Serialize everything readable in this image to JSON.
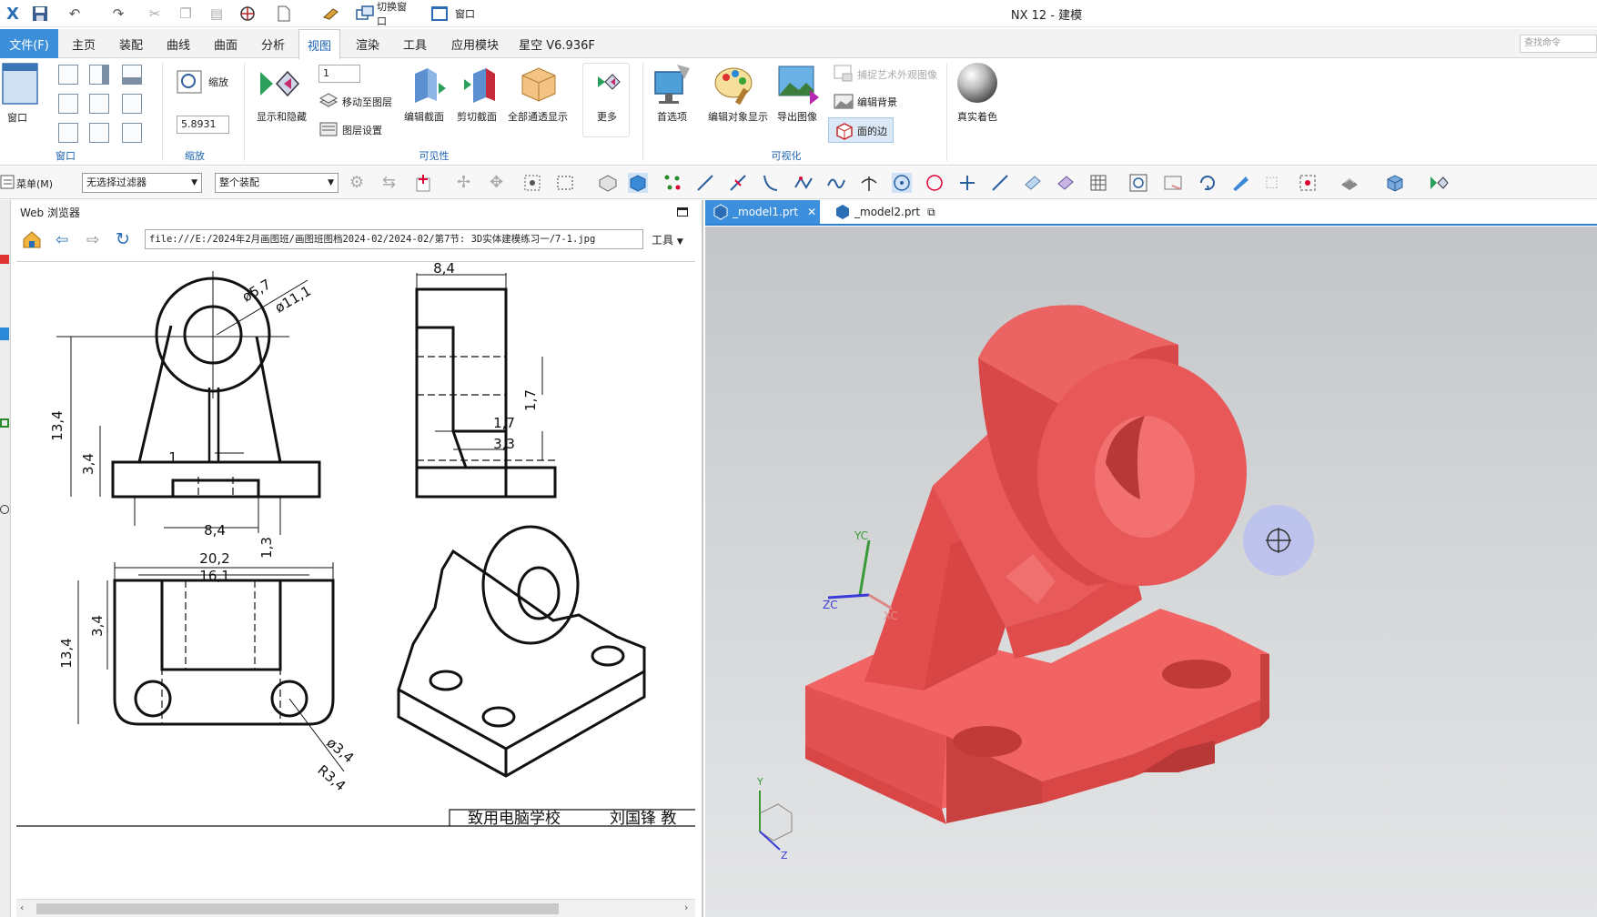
{
  "app": {
    "title": "NX 12 - 建模",
    "logo": "X"
  },
  "menubar": {
    "file": "文件(F)",
    "tabs": [
      "主页",
      "装配",
      "曲线",
      "曲面",
      "分析",
      "视图",
      "渲染",
      "工具",
      "应用模块",
      "星空 V6.936F"
    ],
    "active_tab": "视图",
    "search_placeholder": "查找命令"
  },
  "quick_access": {
    "switch_window": "切换窗口",
    "window": "窗口"
  },
  "ribbon": {
    "window_group": {
      "label": "窗口",
      "button": "窗口"
    },
    "zoom_group": {
      "label": "缩放",
      "zoom_button": "缩放",
      "zoom_value": "5.8931"
    },
    "layer_value": "1",
    "visibility_group": {
      "label": "可见性",
      "show_hide": "显示和隐藏",
      "move_to_layer": "移动至图层",
      "layer_settings": "图层设置",
      "edit_section": "编辑截面",
      "clip_section": "剪切截面",
      "all_transparent": "全部通透显示",
      "more": "更多"
    },
    "visualization_group": {
      "label": "可视化",
      "preferences": "首选项",
      "edit_object_display": "编辑对象显示",
      "export_image": "导出图像",
      "capture_art": "捕捉艺术外观图像",
      "edit_background": "编辑背景",
      "face_edges": "面的边",
      "true_shading": "真实着色"
    }
  },
  "selection_bar": {
    "menu": "菜单(M)",
    "filter": "无选择过滤器",
    "scope": "整个装配"
  },
  "browser": {
    "title": "Web 浏览器",
    "url": "file:///E:/2024年2月画图班/画图班图档2024-02/2024-02/第7节: 3D实体建模练习一/7-1.jpg",
    "tools": "工具",
    "drawing": {
      "dims": [
        "8,4",
        "ø5,7",
        "ø11,1",
        "13,4",
        "3,4",
        "1",
        "8,4",
        "1,3",
        "1,7",
        "1,7",
        "3,3",
        "20,2",
        "16,1",
        "13,4",
        "3,4",
        "ø3,4",
        "R3,4"
      ],
      "title_block": [
        "致用电脑学校",
        "刘国锋 教"
      ]
    }
  },
  "graphics": {
    "tabs": [
      {
        "label": "_model1.prt",
        "active": true
      },
      {
        "label": "_model2.prt",
        "active": false
      }
    ],
    "model_color": "#e85050",
    "axes": [
      "YC",
      "ZC",
      "XC"
    ],
    "triad": [
      "Y",
      "Z"
    ]
  }
}
